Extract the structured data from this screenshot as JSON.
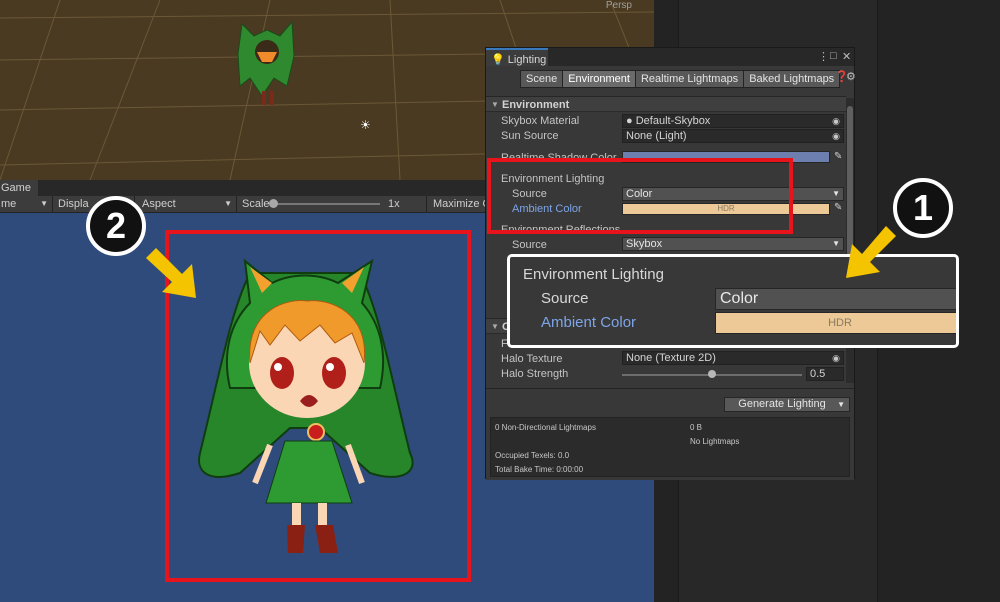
{
  "colors": {
    "ambient": "#ecc996",
    "realtime_shadow": "#6d7fae",
    "accent_red": "#e8141c",
    "arrow_yellow": "#f5c400",
    "game_bg": "#2e4b7c"
  },
  "scene_view": {
    "persp_label": "Persp"
  },
  "game_view": {
    "tab_label": "Game",
    "toolbar": {
      "mode_label": "me",
      "display_label": "Displa",
      "aspect_label": "Aspect",
      "scale_label": "Scale",
      "scale_value": "1x",
      "maximize_label": "Maximize On"
    }
  },
  "lighting_window": {
    "title": "Lighting",
    "tabs": [
      "Scene",
      "Environment",
      "Realtime Lightmaps",
      "Baked Lightmaps"
    ],
    "active_tab": "Environment",
    "environment": {
      "header": "Environment",
      "skybox_material_label": "Skybox Material",
      "skybox_material_value": "Default-Skybox",
      "sun_source_label": "Sun Source",
      "sun_source_value": "None (Light)",
      "realtime_shadow_label": "Realtime Shadow Color",
      "env_lighting_label": "Environment Lighting",
      "source_label": "Source",
      "source_value": "Color",
      "ambient_color_label": "Ambient Color",
      "ambient_hdr": "HDR",
      "env_reflections_label": "Environment Reflections",
      "refl_source_label": "Source",
      "refl_source_value": "Skybox"
    },
    "other": {
      "header_letter": "O",
      "f_label": "F",
      "halo_texture_label": "Halo Texture",
      "halo_texture_value": "None (Texture 2D)",
      "halo_strength_label": "Halo Strength",
      "halo_strength_value": "0.5",
      "halo_strength_fraction": 0.5
    },
    "generate_button": "Generate Lighting",
    "stats": {
      "lightmaps": "0 Non-Directional Lightmaps",
      "size": "0 B",
      "no_lightmaps": "No Lightmaps",
      "occupied": "Occupied Texels: 0.0",
      "bake_time": "Total Bake Time: 0:00:00"
    }
  },
  "zoom_inset": {
    "title": "Environment Lighting",
    "source_label": "Source",
    "source_value": "Color",
    "ambient_label": "Ambient Color",
    "ambient_hdr": "HDR"
  },
  "badges": {
    "one": "1",
    "two": "2"
  }
}
